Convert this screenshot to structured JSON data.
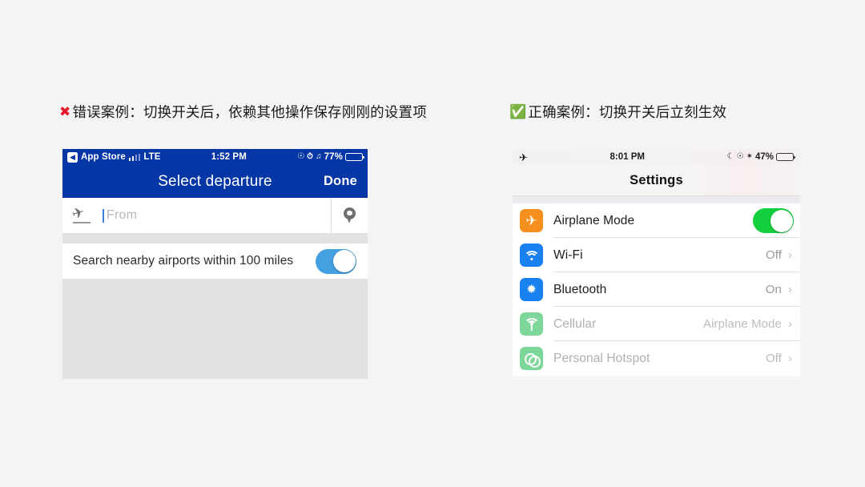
{
  "captions": {
    "bad": {
      "mark": "✖",
      "text": "错误案例：切换开关后，依赖其他操作保存刚刚的设置项"
    },
    "good": {
      "mark": "✅",
      "text": "正确案例：切换开关后立刻生效"
    }
  },
  "left_phone": {
    "status_bar": {
      "back_glyph": "◀",
      "back_app": "App Store",
      "carrier": "LTE",
      "time": "1:52 PM",
      "icons": [
        "☉",
        "⏱",
        "♫"
      ],
      "battery_percent": "77%",
      "battery_level": 77
    },
    "nav_bar": {
      "title": "Select departure",
      "done_label": "Done"
    },
    "from_row": {
      "icon": "airplane-depart-icon",
      "placeholder": "From",
      "value": "",
      "pin_icon": "location-pin-icon"
    },
    "toggle_row": {
      "label": "Search nearby airports within 100 miles",
      "state": "on",
      "color": "#44a0e0"
    }
  },
  "right_phone": {
    "status_bar": {
      "airplane_glyph": "✈",
      "time": "8:01 PM",
      "icons": [
        "☾",
        "☉",
        "✶"
      ],
      "battery_percent": "47%",
      "battery_level": 47
    },
    "header": {
      "title": "Settings"
    },
    "rows": [
      {
        "icon": "airplane-icon",
        "icon_color": "#f5901f",
        "label": "Airplane Mode",
        "control": "switch",
        "state": "on",
        "switch_color": "#14cf3d",
        "dimmed": false
      },
      {
        "icon": "wifi-icon",
        "icon_color": "#1a82f0",
        "label": "Wi-Fi",
        "control": "value",
        "value": "Off",
        "dimmed": false
      },
      {
        "icon": "bluetooth-icon",
        "icon_color": "#1a82f0",
        "label": "Bluetooth",
        "control": "value",
        "value": "On",
        "dimmed": false
      },
      {
        "icon": "cellular-icon",
        "icon_color": "#7ed79a",
        "label": "Cellular",
        "control": "value",
        "value": "Airplane Mode",
        "dimmed": true
      },
      {
        "icon": "personal-hotspot-icon",
        "icon_color": "#7ed79a",
        "label": "Personal Hotspot",
        "control": "value",
        "value": "Off",
        "dimmed": true
      }
    ]
  },
  "theme": {
    "page_bg": "#f4f4f4",
    "nav_blue": "#0536a5",
    "switch_blue": "#44a0e0",
    "switch_green": "#14cf3d"
  }
}
